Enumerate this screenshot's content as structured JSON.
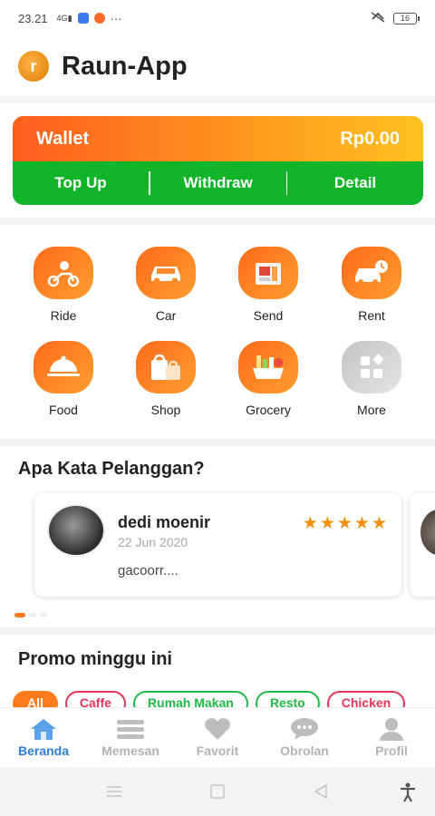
{
  "status_bar": {
    "time": "23.21",
    "signal": "4G",
    "battery": "16",
    "more": "···"
  },
  "header": {
    "title": "Raun-App"
  },
  "wallet": {
    "label": "Wallet",
    "balance": "Rp0.00",
    "actions": [
      "Top Up",
      "Withdraw",
      "Detail"
    ],
    "colors": {
      "gradient_start": "#ff5e1e",
      "gradient_end": "#ffc21e",
      "action_bar": "#12b52a"
    }
  },
  "services": [
    {
      "label": "Ride",
      "icon": "scooter-icon"
    },
    {
      "label": "Car",
      "icon": "car-icon"
    },
    {
      "label": "Send",
      "icon": "package-icon"
    },
    {
      "label": "Rent",
      "icon": "car-rental-icon"
    },
    {
      "label": "Food",
      "icon": "food-cloche-icon"
    },
    {
      "label": "Shop",
      "icon": "shopping-bags-icon"
    },
    {
      "label": "Grocery",
      "icon": "grocery-basket-icon"
    },
    {
      "label": "More",
      "icon": "more-grid-icon"
    }
  ],
  "reviews": {
    "title": "Apa Kata Pelanggan?",
    "items": [
      {
        "name": "dedi moenir",
        "date": "22 Jun 2020",
        "text": "gacoorr....",
        "rating": 5
      }
    ]
  },
  "promo": {
    "title": "Promo minggu ini",
    "chips": [
      "All",
      "Caffe",
      "Rumah Makan",
      "Resto",
      "Chicken"
    ]
  },
  "bottom_nav": [
    {
      "label": "Beranda",
      "icon": "home-icon",
      "active": true
    },
    {
      "label": "Memesan",
      "icon": "list-icon",
      "active": false
    },
    {
      "label": "Favorit",
      "icon": "heart-icon",
      "active": false
    },
    {
      "label": "Obrolan",
      "icon": "chat-icon",
      "active": false
    },
    {
      "label": "Profil",
      "icon": "user-icon",
      "active": false
    }
  ],
  "theme": {
    "accent": "#ff7a1a",
    "active_nav": "#2b7fd4",
    "inactive_nav": "#b3b3b3",
    "star": "#f0900a"
  }
}
